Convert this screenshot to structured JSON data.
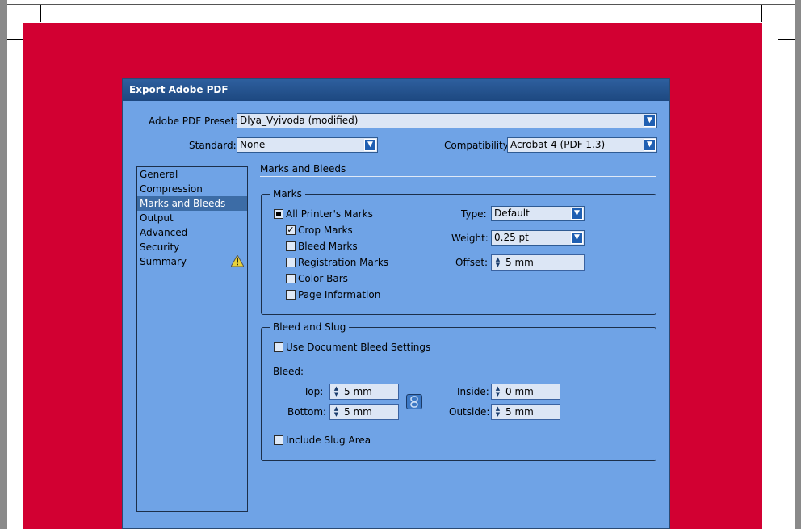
{
  "dialog": {
    "title": "Export Adobe PDF",
    "preset_label": "Adobe PDF Preset:",
    "preset_value": "Dlya_Vyivoda (modified)",
    "standard_label": "Standard:",
    "standard_value": "None",
    "compatibility_label": "Compatibility:",
    "compatibility_value": "Acrobat 4 (PDF 1.3)"
  },
  "nav": {
    "items": [
      "General",
      "Compression",
      "Marks and Bleeds",
      "Output",
      "Advanced",
      "Security",
      "Summary"
    ],
    "selected": "Marks and Bleeds"
  },
  "section": {
    "title": "Marks and Bleeds"
  },
  "marks": {
    "group_title": "Marks",
    "all_printers_marks": "All Printer's Marks",
    "crop_marks": "Crop Marks",
    "bleed_marks": "Bleed Marks",
    "registration_marks": "Registration Marks",
    "color_bars": "Color Bars",
    "page_information": "Page Information",
    "type_label": "Type:",
    "type_value": "Default",
    "weight_label": "Weight:",
    "weight_value": "0.25 pt",
    "offset_label": "Offset:",
    "offset_value": "5 mm"
  },
  "bleed": {
    "group_title": "Bleed and Slug",
    "use_document": "Use Document Bleed Settings",
    "bleed_label": "Bleed:",
    "top_label": "Top:",
    "top_value": "5 mm",
    "bottom_label": "Bottom:",
    "bottom_value": "5 mm",
    "inside_label": "Inside:",
    "inside_value": "0 mm",
    "outside_label": "Outside:",
    "outside_value": "5 mm",
    "include_slug": "Include Slug Area"
  },
  "icons": {
    "dropdown": "chevron-down-icon",
    "spinner": "spinner-icon",
    "warning": "warning-icon",
    "link": "chain-link-icon",
    "check": "checkmark-icon"
  },
  "colors": {
    "dialog_bg": "#6fa3e6",
    "bleed_area": "#d20032",
    "titlebar": "#1d4880",
    "selection": "#3c6ca6"
  }
}
